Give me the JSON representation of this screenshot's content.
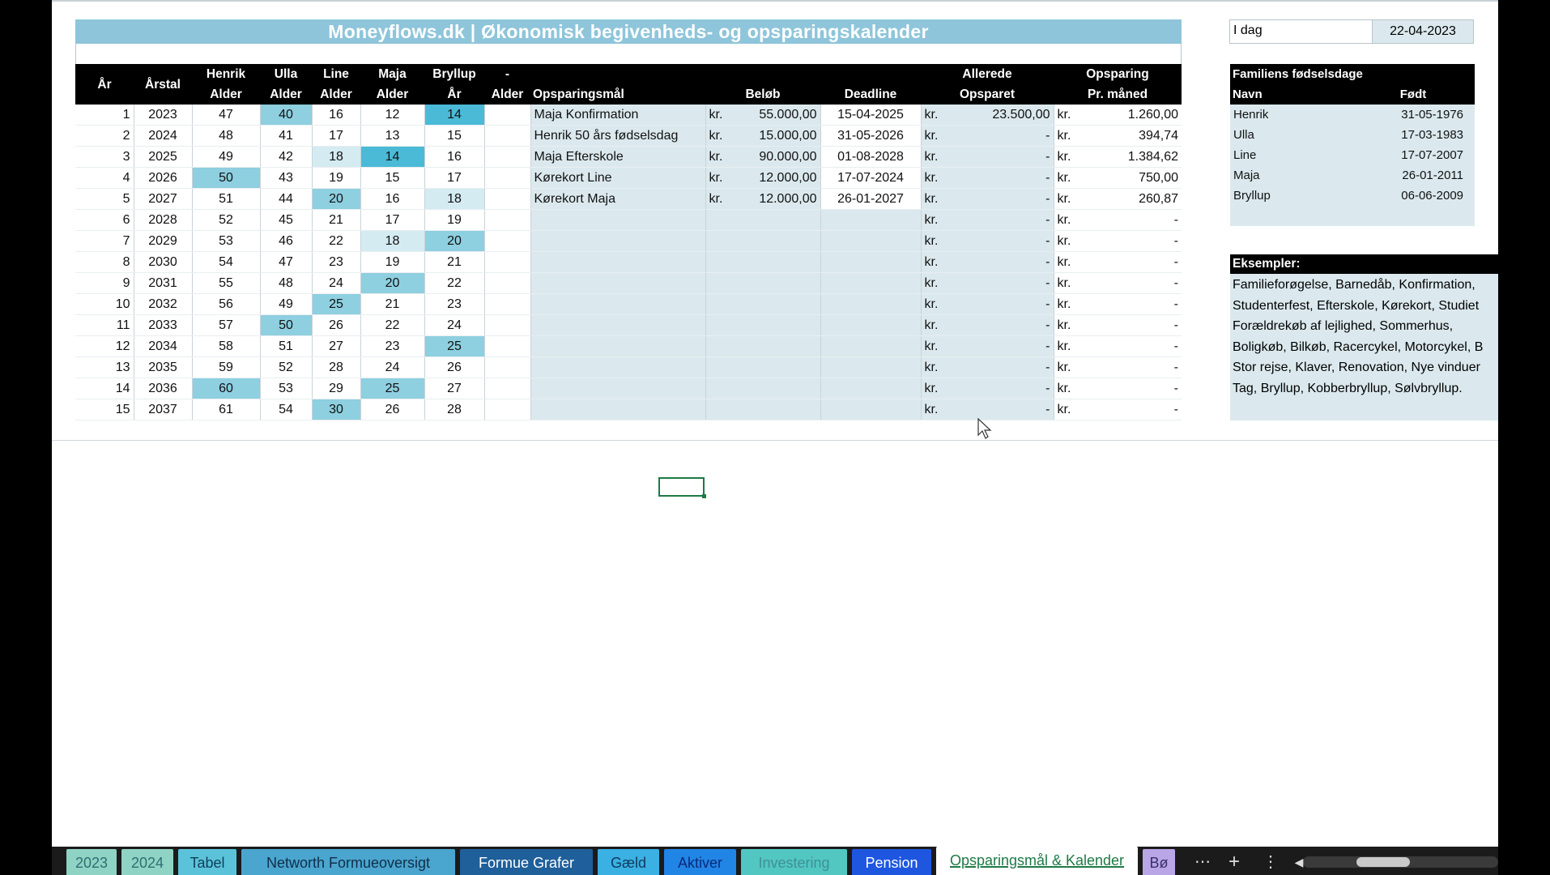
{
  "title": "Moneyflows.dk | Økonomisk begivenheds- og opsparingskalender",
  "today": {
    "label": "I dag",
    "value": "22-04-2023"
  },
  "headers": {
    "aar": "År",
    "aarstal": "Årstal",
    "henrik": [
      "Henrik",
      "Alder"
    ],
    "ulla": [
      "Ulla",
      "Alder"
    ],
    "line": [
      "Line",
      "Alder"
    ],
    "maja": [
      "Maja",
      "Alder"
    ],
    "bryllup": [
      "Bryllup",
      "År"
    ],
    "extra": [
      "-",
      "Alder"
    ],
    "goal": "Opsparingsmål",
    "amount": "Beløb",
    "deadline": "Deadline",
    "saved": [
      "Allerede",
      "Opsparet"
    ],
    "monthly": [
      "Opsparing",
      "Pr. måned"
    ]
  },
  "currency": "kr.",
  "rows": [
    {
      "n": "1",
      "year": "2023",
      "h": "47",
      "u": "40",
      "l": "16",
      "m": "12",
      "b": "14",
      "goal": "Maja Konfirmation",
      "amount": "55.000,00",
      "deadline": "15-04-2025",
      "saved": "23.500,00",
      "monthly": "1.260,00"
    },
    {
      "n": "2",
      "year": "2024",
      "h": "48",
      "u": "41",
      "l": "17",
      "m": "13",
      "b": "15",
      "goal": "Henrik 50 års fødselsdag",
      "amount": "15.000,00",
      "deadline": "31-05-2026",
      "saved": "-",
      "monthly": "394,74"
    },
    {
      "n": "3",
      "year": "2025",
      "h": "49",
      "u": "42",
      "l": "18",
      "m": "14",
      "b": "16",
      "goal": "Maja Efterskole",
      "amount": "90.000,00",
      "deadline": "01-08-2028",
      "saved": "-",
      "monthly": "1.384,62"
    },
    {
      "n": "4",
      "year": "2026",
      "h": "50",
      "u": "43",
      "l": "19",
      "m": "15",
      "b": "17",
      "goal": "Kørekort Line",
      "amount": "12.000,00",
      "deadline": "17-07-2024",
      "saved": "-",
      "monthly": "750,00"
    },
    {
      "n": "5",
      "year": "2027",
      "h": "51",
      "u": "44",
      "l": "20",
      "m": "16",
      "b": "18",
      "goal": "Kørekort Maja",
      "amount": "12.000,00",
      "deadline": "26-01-2027",
      "saved": "-",
      "monthly": "260,87"
    },
    {
      "n": "6",
      "year": "2028",
      "h": "52",
      "u": "45",
      "l": "21",
      "m": "17",
      "b": "19",
      "goal": "",
      "amount": "",
      "deadline": "",
      "saved": "-",
      "monthly": "-"
    },
    {
      "n": "7",
      "year": "2029",
      "h": "53",
      "u": "46",
      "l": "22",
      "m": "18",
      "b": "20",
      "goal": "",
      "amount": "",
      "deadline": "",
      "saved": "-",
      "monthly": "-"
    },
    {
      "n": "8",
      "year": "2030",
      "h": "54",
      "u": "47",
      "l": "23",
      "m": "19",
      "b": "21",
      "goal": "",
      "amount": "",
      "deadline": "",
      "saved": "-",
      "monthly": "-"
    },
    {
      "n": "9",
      "year": "2031",
      "h": "55",
      "u": "48",
      "l": "24",
      "m": "20",
      "b": "22",
      "goal": "",
      "amount": "",
      "deadline": "",
      "saved": "-",
      "monthly": "-"
    },
    {
      "n": "10",
      "year": "2032",
      "h": "56",
      "u": "49",
      "l": "25",
      "m": "21",
      "b": "23",
      "goal": "",
      "amount": "",
      "deadline": "",
      "saved": "-",
      "monthly": "-"
    },
    {
      "n": "11",
      "year": "2033",
      "h": "57",
      "u": "50",
      "l": "26",
      "m": "22",
      "b": "24",
      "goal": "",
      "amount": "",
      "deadline": "",
      "saved": "-",
      "monthly": "-"
    },
    {
      "n": "12",
      "year": "2034",
      "h": "58",
      "u": "51",
      "l": "27",
      "m": "23",
      "b": "25",
      "goal": "",
      "amount": "",
      "deadline": "",
      "saved": "-",
      "monthly": "-"
    },
    {
      "n": "13",
      "year": "2035",
      "h": "59",
      "u": "52",
      "l": "28",
      "m": "24",
      "b": "26",
      "goal": "",
      "amount": "",
      "deadline": "",
      "saved": "-",
      "monthly": "-"
    },
    {
      "n": "14",
      "year": "2036",
      "h": "60",
      "u": "53",
      "l": "29",
      "m": "25",
      "b": "27",
      "goal": "",
      "amount": "",
      "deadline": "",
      "saved": "-",
      "monthly": "-"
    },
    {
      "n": "15",
      "year": "2037",
      "h": "61",
      "u": "54",
      "l": "30",
      "m": "26",
      "b": "28",
      "goal": "",
      "amount": "",
      "deadline": "",
      "saved": "-",
      "monthly": "-"
    }
  ],
  "family": {
    "title": "Familiens fødselsdage",
    "name_header": "Navn",
    "born_header": "Født",
    "members": [
      {
        "name": "Henrik",
        "born": "31-05-1976"
      },
      {
        "name": "Ulla",
        "born": "17-03-1983"
      },
      {
        "name": "Line",
        "born": "17-07-2007"
      },
      {
        "name": "Maja",
        "born": "26-01-2011"
      },
      {
        "name": "Bryllup",
        "born": "06-06-2009"
      }
    ]
  },
  "examples": {
    "title": "Eksempler:",
    "lines": [
      "Familieforøgelse, Barnedåb, Konfirmation,",
      "Studenterfest, Efterskole, Kørekort, Studiet",
      "Forældrekøb af lejlighed, Sommerhus,",
      "Boligkøb, Bilkøb, Racercykel, Motorcykel, B",
      "Stor rejse, Klaver, Renovation, Nye vinduer",
      "Tag, Bryllup, Kobberbryllup, Sølvbryllup."
    ]
  },
  "sheet_tabs": [
    {
      "label": "2023",
      "bg": "#8fd3c4",
      "fg": "#2f6e73"
    },
    {
      "label": "2024",
      "bg": "#8fd3c4",
      "fg": "#2f6e73"
    },
    {
      "label": "Tabel",
      "bg": "#5bc3d9",
      "fg": "#0f3f59"
    },
    {
      "label": "Networth Formueoversigt",
      "bg": "#4aa5cf",
      "fg": "#0f2f4a"
    },
    {
      "label": "Formue Grafer",
      "bg": "#1f5f9a",
      "fg": "#ffffff"
    },
    {
      "label": "Gæld",
      "bg": "#3ab0e3",
      "fg": "#0f3a5f"
    },
    {
      "label": "Aktiver",
      "bg": "#2185e5",
      "fg": "#0b2a7a"
    },
    {
      "label": "Investering",
      "bg": "#52c7c2",
      "fg": "#3f8f9a"
    },
    {
      "label": "Pension",
      "bg": "#1e56e0",
      "fg": "#ffffff"
    },
    {
      "label": "Opsparingsmål & Kalender",
      "bg": "#ffffff",
      "fg": "#1e7a45"
    },
    {
      "label": "Bø",
      "bg": "#b9a6e6",
      "fg": "#3a2e70"
    }
  ],
  "tab_icons": [
    "more-tabs-icon",
    "add-sheet-icon",
    "options-icon",
    "scroll-left-icon"
  ]
}
